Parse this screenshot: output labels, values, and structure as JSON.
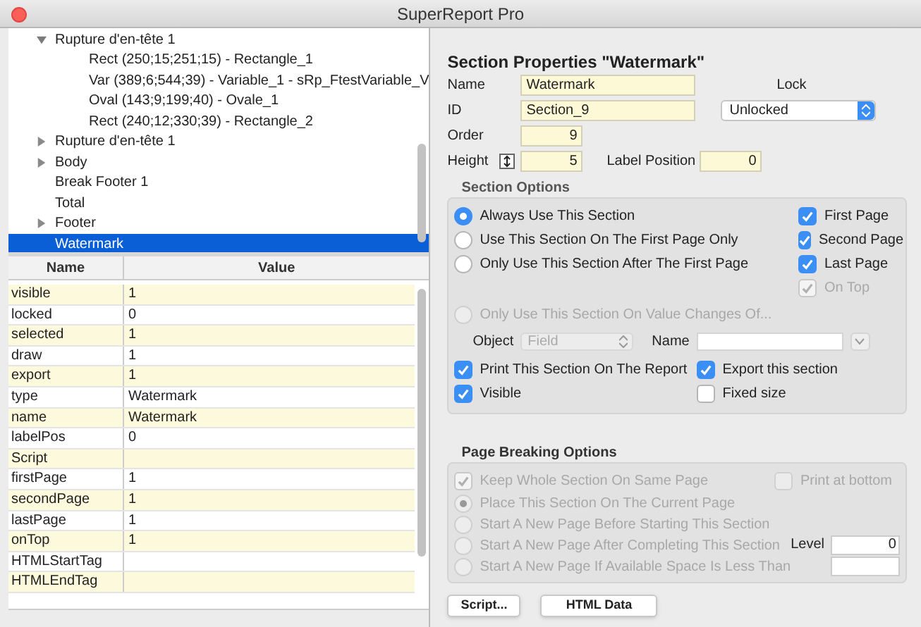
{
  "window": {
    "title": "SuperReport Pro"
  },
  "tree": [
    {
      "label": "Rupture d'en-tête 1",
      "expanded": true,
      "selected": false,
      "children": [
        {
          "label": "Rect (250;15;251;15) - Rectangle_1",
          "selected": false
        },
        {
          "label": "Var (389;6;544;39) - Variable_1 - sRp_FtestVariable_V",
          "selected": false
        },
        {
          "label": "Oval (143;9;199;40) - Ovale_1",
          "selected": false
        },
        {
          "label": "Rect (240;12;330;39) - Rectangle_2",
          "selected": false
        }
      ]
    },
    {
      "label": "Rupture d'en-tête 1",
      "expanded": false,
      "selected": false
    },
    {
      "label": "Body",
      "expanded": false,
      "selected": false
    },
    {
      "label": "Break Footer 1",
      "selected": false
    },
    {
      "label": "Total",
      "selected": false
    },
    {
      "label": "Footer",
      "expanded": false,
      "selected": false
    },
    {
      "label": "Watermark",
      "selected": true
    }
  ],
  "properties": {
    "columns": [
      "Name",
      "Value"
    ],
    "rows": [
      {
        "name": "visible",
        "value": "1"
      },
      {
        "name": "locked",
        "value": "0"
      },
      {
        "name": "selected",
        "value": "1"
      },
      {
        "name": "draw",
        "value": "1"
      },
      {
        "name": "export",
        "value": "1"
      },
      {
        "name": "type",
        "value": "Watermark"
      },
      {
        "name": "name",
        "value": "Watermark"
      },
      {
        "name": "labelPos",
        "value": "0"
      },
      {
        "name": "Script",
        "value": ""
      },
      {
        "name": "firstPage",
        "value": "1"
      },
      {
        "name": "secondPage",
        "value": "1"
      },
      {
        "name": "lastPage",
        "value": "1"
      },
      {
        "name": "onTop",
        "value": "1"
      },
      {
        "name": "HTMLStartTag",
        "value": ""
      },
      {
        "name": "HTMLEndTag",
        "value": ""
      }
    ]
  },
  "section": {
    "title": "Section Properties \"Watermark\"",
    "name_label": "Name",
    "name_value": "Watermark",
    "id_label": "ID",
    "id_value": "Section_9",
    "lock_label": "Lock",
    "lock_value": "Unlocked",
    "order_label": "Order",
    "order_value": "9",
    "height_label": "Height",
    "height_value": "5",
    "label_position_label": "Label Position",
    "label_position_value": "0"
  },
  "section_options": {
    "title": "Section Options",
    "radios": [
      {
        "label": "Always Use This Section",
        "selected": true,
        "disabled": false
      },
      {
        "label": "Use This Section On The First Page Only",
        "selected": false,
        "disabled": false
      },
      {
        "label": "Only Use This Section After The First Page",
        "selected": false,
        "disabled": false
      }
    ],
    "page_checks": [
      {
        "label": "First Page",
        "checked": true,
        "disabled": false
      },
      {
        "label": "Second Page",
        "checked": true,
        "disabled": false
      },
      {
        "label": "Last Page",
        "checked": true,
        "disabled": false
      },
      {
        "label": "On Top",
        "checked": true,
        "disabled": true
      }
    ],
    "value_changes": {
      "label": "Only Use This Section On Value Changes Of...",
      "selected": false,
      "disabled": true
    },
    "object_label": "Object",
    "object_value": "Field",
    "name_label": "Name",
    "checks": [
      {
        "label": "Print This Section On The Report",
        "checked": true,
        "disabled": false
      },
      {
        "label": "Export this section",
        "checked": true,
        "disabled": false
      },
      {
        "label": "Visible",
        "checked": true,
        "disabled": false
      },
      {
        "label": "Fixed size",
        "checked": false,
        "disabled": false
      }
    ]
  },
  "page_breaking": {
    "title": "Page Breaking Options",
    "keep": {
      "label": "Keep Whole Section On Same Page",
      "checked": true,
      "disabled": true
    },
    "bottom": {
      "label": "Print at bottom",
      "checked": false,
      "disabled": true
    },
    "radios": [
      {
        "label": "Place This Section On The Current Page",
        "selected": true,
        "disabled": true
      },
      {
        "label": "Start A New Page Before Starting This Section",
        "selected": false,
        "disabled": true
      },
      {
        "label": "Start A New Page After Completing This Section",
        "selected": false,
        "disabled": true
      },
      {
        "label": "Start A New Page If Available Space Is Less Than",
        "selected": false,
        "disabled": true
      }
    ],
    "level_label": "Level",
    "level_value": "0"
  },
  "buttons": [
    "Script...",
    "HTML Data"
  ]
}
